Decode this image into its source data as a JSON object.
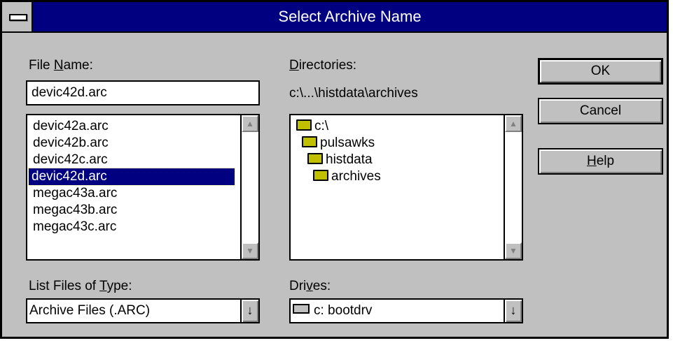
{
  "window": {
    "title": "Select Archive Name"
  },
  "file_name": {
    "label_pre": "File ",
    "label_accel": "N",
    "label_post": "ame:",
    "value": "devic42d.arc",
    "items": [
      "devic42a.arc",
      "devic42b.arc",
      "devic42c.arc",
      "devic42d.arc",
      "megac43a.arc",
      "megac43b.arc",
      "megac43c.arc"
    ],
    "selected_index": 3
  },
  "directories": {
    "label_accel": "D",
    "label_post": "irectories:",
    "current_path": "c:\\...\\histdata\\archives",
    "items": [
      {
        "label": "c:\\",
        "icon": "open-folder-icon"
      },
      {
        "label": "pulsawks",
        "icon": "open-folder-icon"
      },
      {
        "label": "histdata",
        "icon": "open-folder-icon"
      },
      {
        "label": "archives",
        "icon": "open-folder-icon"
      }
    ]
  },
  "file_type": {
    "label_pre": "List Files of ",
    "label_accel": "T",
    "label_post": "ype:",
    "value": "Archive Files (.ARC)"
  },
  "drives": {
    "label_pre": "Dri",
    "label_accel": "v",
    "label_post": "es:",
    "value": "c: bootdrv",
    "icon": "drive-icon"
  },
  "buttons": {
    "ok": "OK",
    "cancel": "Cancel",
    "help_accel": "H",
    "help_post": "elp"
  },
  "icons": {
    "system_menu": "system-menu-icon",
    "scroll_up": "up-arrow-icon",
    "scroll_down": "down-arrow-icon",
    "dropdown": "down-arrow-icon"
  }
}
